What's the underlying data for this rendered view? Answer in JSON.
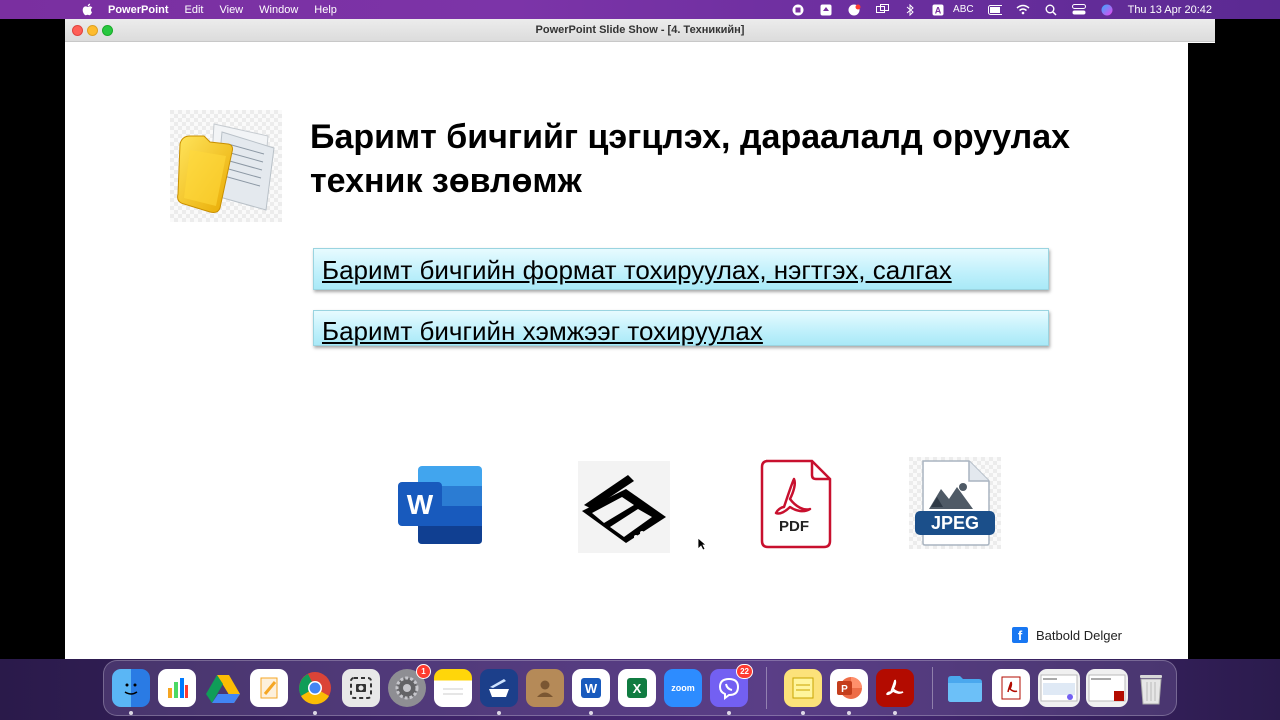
{
  "menubar": {
    "app_name": "PowerPoint",
    "menus": [
      "Edit",
      "View",
      "Window",
      "Help"
    ],
    "input_source": "ABC",
    "clock": "Thu 13 Apr  20:42"
  },
  "window": {
    "title": "PowerPoint Slide Show - [4. Техникийн]"
  },
  "slide": {
    "title": "Баримт бичгийг цэгцлэх, дараалалд оруулах техник зөвлөмж",
    "topics": [
      "Баримт бичгийн формат тохируулах, нэгтгэх, салгах",
      "Баримт бичгийн хэмжээг тохируулах"
    ],
    "icons": {
      "word_letter": "W",
      "pdf_label": "PDF",
      "jpeg_label": "JPEG"
    },
    "credit": "Batbold Delger",
    "colors": {
      "topic_box": "#bff0fb",
      "word_blue": "#185abd",
      "pdf_red": "#c8102e",
      "fb_blue": "#1877f2"
    }
  },
  "dock": {
    "badges": {
      "system_settings": "1",
      "viber": "22"
    },
    "labels": {
      "zoom": "zoom",
      "word": "W",
      "excel": "X"
    }
  }
}
